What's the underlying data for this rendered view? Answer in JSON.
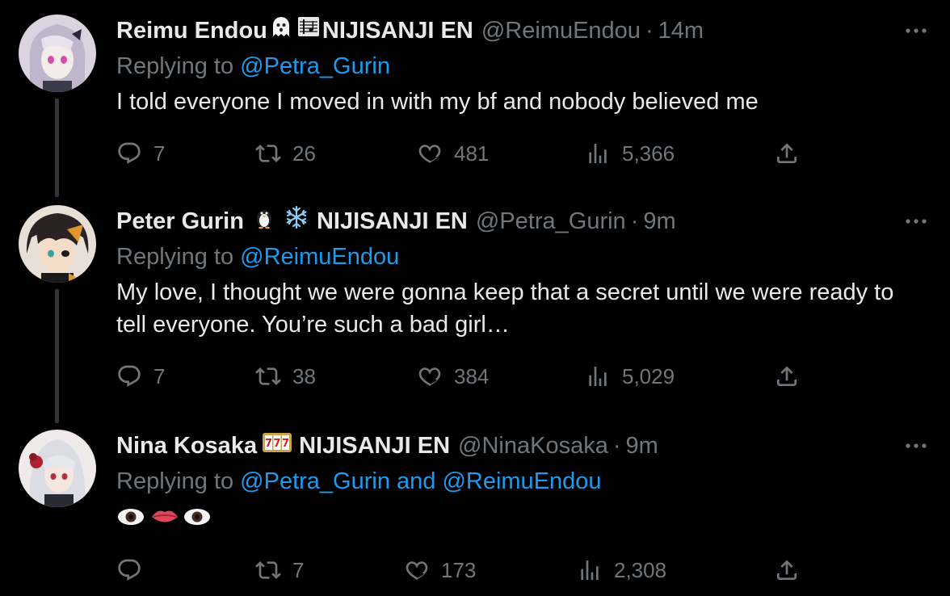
{
  "tweets": [
    {
      "name": "Reimu Endou",
      "org": "NIJISANJI EN",
      "handle": "@ReimuEndou",
      "dot": "·",
      "time": "14m",
      "replying_prefix": "Replying to",
      "replying_mentions": "@Petra_Gurin",
      "text": "I told everyone I moved in with my bf and nobody believed me",
      "replies": "7",
      "retweets": "26",
      "likes": "481",
      "views": "5,366",
      "emoji": [
        "ghost-icon",
        "music-score-icon"
      ]
    },
    {
      "name": "Peter Gurin",
      "org": "NIJISANJI EN",
      "handle": "@Petra_Gurin",
      "dot": "·",
      "time": "9m",
      "replying_prefix": "Replying to",
      "replying_mentions": "@ReimuEndou",
      "text": "My love, I thought we were gonna keep that a secret until we were ready to tell everyone. You’re such a bad girl…",
      "replies": "7",
      "retweets": "38",
      "likes": "384",
      "views": "5,029",
      "emoji": [
        "penguin-icon",
        "snowflake-icon"
      ]
    },
    {
      "name": "Nina Kosaka",
      "org": "NIJISANJI EN",
      "handle": "@NinaKosaka",
      "dot": "·",
      "time": "9m",
      "replying_prefix": "Replying to",
      "replying_mentions": "@Petra_Gurin and @ReimuEndou",
      "text": "👁👄👁",
      "replies": "",
      "retweets": "7",
      "likes": "173",
      "views": "2,308",
      "emoji": [
        "slot-machine-777-icon"
      ]
    }
  ],
  "colors": {
    "background": "#000000",
    "text_primary": "#e7e9ea",
    "text_secondary": "#71767b",
    "mention_blue": "#1d9bf0",
    "thread_line": "#333639"
  }
}
